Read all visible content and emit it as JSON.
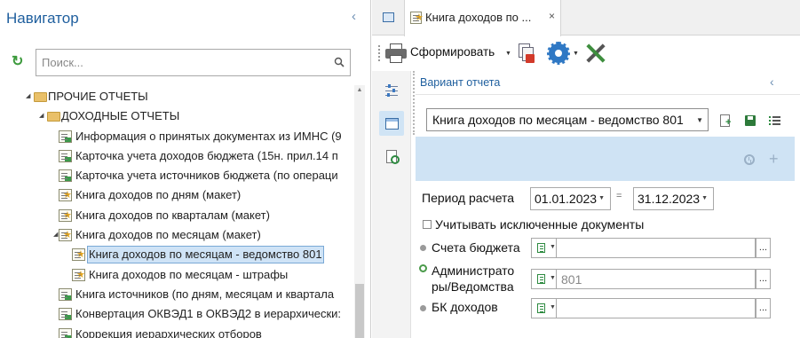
{
  "navigator": {
    "title": "Навигатор",
    "collapse_glyph": "‹",
    "search": {
      "placeholder": "Поиск...",
      "value": ""
    },
    "tree": [
      {
        "label": "ПРОЧИЕ ОТЧЕТЫ",
        "icon": "folder-icon",
        "expanded": true
      },
      {
        "label": "ДОХОДНЫЕ ОТЧЕТЫ",
        "icon": "folder-icon",
        "expanded": true
      },
      {
        "label": "Информация о принятых документах из ИМНС (9",
        "icon": "report-icon"
      },
      {
        "label": "Карточка учета доходов бюджета (15н. прил.14 п",
        "icon": "report-icon"
      },
      {
        "label": "Карточка учета источников бюджета (по операци",
        "icon": "report-icon"
      },
      {
        "label": "Книга доходов по дням (макет)",
        "icon": "report-template-icon"
      },
      {
        "label": "Книга доходов по кварталам (макет)",
        "icon": "report-template-icon"
      },
      {
        "label": "Книга доходов по месяцам (макет)",
        "icon": "report-template-icon",
        "expanded": true
      },
      {
        "label": "Книга доходов по месяцам - ведомство 801",
        "icon": "report-template-icon",
        "selected": true
      },
      {
        "label": "Книга доходов по месяцам - штрафы",
        "icon": "report-template-icon"
      },
      {
        "label": "Книга источников (по дням, месяцам и квартала",
        "icon": "report-icon"
      },
      {
        "label": "Конвертация ОКВЭД1 в ОКВЭД2 в иерархически:",
        "icon": "report-icon"
      },
      {
        "label": "Коррекция иерархических отборов",
        "icon": "report-icon"
      }
    ]
  },
  "tabs": {
    "active_label": "Книга доходов по ...",
    "close_glyph": "×"
  },
  "toolbar": {
    "form_label": "Сформировать"
  },
  "variant": {
    "title": "Вариант отчета",
    "collapse_glyph": "‹",
    "selected": "Книга доходов по месяцам - ведомство 801"
  },
  "params": {
    "period_label": "Период расчета",
    "date_from": "01.01.2023",
    "date_to": "31.12.2023",
    "exclude_label": "Учитывать исключенные документы",
    "exclude_checked": false,
    "accounts_label": "Счета бюджета",
    "accounts_value": "",
    "admin_label_line1": "Администрато",
    "admin_label_line2": "ры/Ведомства",
    "admin_value": "801",
    "bk_label": "БК доходов",
    "bk_value": ""
  },
  "colors": {
    "accent": "#1f5f9e",
    "selection": "#cfe3f6",
    "band": "#cfe3f4"
  }
}
